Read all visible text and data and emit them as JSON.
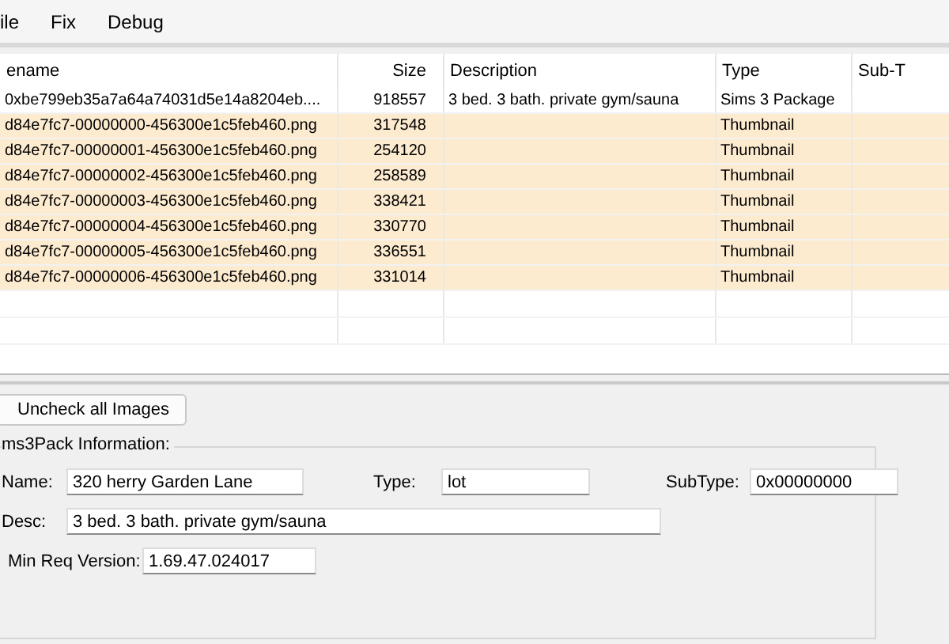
{
  "menu": [
    "ile",
    "Fix",
    "Debug"
  ],
  "table": {
    "columns": [
      "ename",
      "Size",
      "Description",
      "Type",
      "Sub-T"
    ],
    "rows": [
      {
        "cells": [
          "0xbe799eb35a7a64a74031d5e14a8204eb....",
          "918557",
          "3 bed. 3 bath. private gym/sauna",
          "Sims 3 Package",
          ""
        ],
        "highlighted": false
      },
      {
        "cells": [
          "d84e7fc7-00000000-456300e1c5feb460.png",
          "317548",
          "",
          "Thumbnail",
          ""
        ],
        "highlighted": true
      },
      {
        "cells": [
          "d84e7fc7-00000001-456300e1c5feb460.png",
          "254120",
          "",
          "Thumbnail",
          ""
        ],
        "highlighted": true
      },
      {
        "cells": [
          "d84e7fc7-00000002-456300e1c5feb460.png",
          "258589",
          "",
          "Thumbnail",
          ""
        ],
        "highlighted": true
      },
      {
        "cells": [
          "d84e7fc7-00000003-456300e1c5feb460.png",
          "338421",
          "",
          "Thumbnail",
          ""
        ],
        "highlighted": true
      },
      {
        "cells": [
          "d84e7fc7-00000004-456300e1c5feb460.png",
          "330770",
          "",
          "Thumbnail",
          ""
        ],
        "highlighted": true
      },
      {
        "cells": [
          "d84e7fc7-00000005-456300e1c5feb460.png",
          "336551",
          "",
          "Thumbnail",
          ""
        ],
        "highlighted": true
      },
      {
        "cells": [
          "d84e7fc7-00000006-456300e1c5feb460.png",
          "331014",
          "",
          "Thumbnail",
          ""
        ],
        "highlighted": true
      }
    ]
  },
  "uncheck_button": "Uncheck all Images",
  "info": {
    "title": "ms3Pack Information:",
    "name_label": "Name:",
    "name": "320 herry Garden Lane",
    "type_label": "Type:",
    "type": "lot",
    "subtype_label": "SubType:",
    "subtype": "0x00000000",
    "desc_label": "Desc:",
    "desc": "3 bed. 3 bath. private gym/sauna",
    "version_label": "Min Req Version:",
    "version": "1.69.47.024017"
  }
}
